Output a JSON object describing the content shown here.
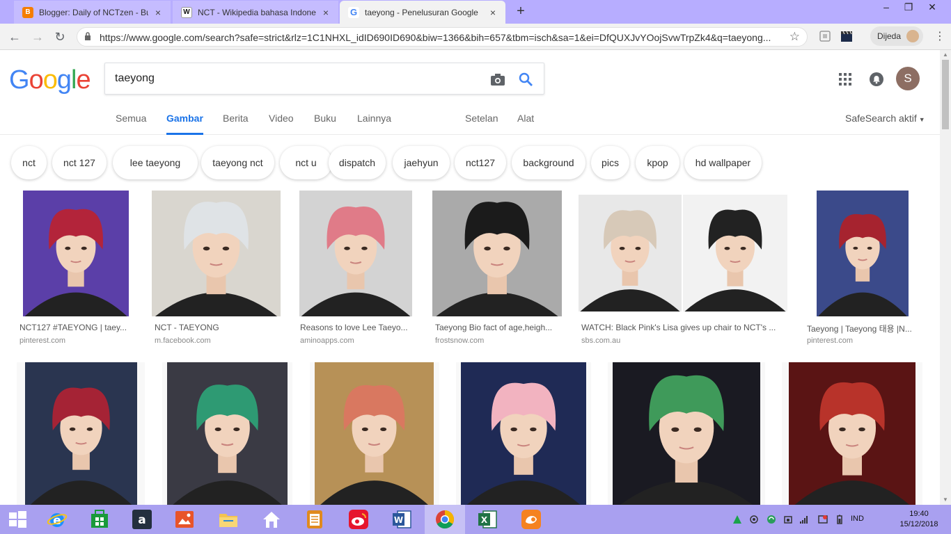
{
  "browser": {
    "tabs": [
      {
        "title": "Blogger: Daily of NCTzen - Buat e",
        "favicon": "blogger-icon",
        "favicon_color": "#f57d00",
        "favicon_letter": "B"
      },
      {
        "title": "NCT - Wikipedia bahasa Indonesi",
        "favicon": "wikipedia-icon",
        "favicon_color": "#ffffff",
        "favicon_letter": "W"
      },
      {
        "title": "taeyong - Penelusuran Google",
        "favicon": "google-icon",
        "favicon_color": "#4285f4",
        "favicon_letter": "G"
      }
    ],
    "url": "https://www.google.com/search?safe=strict&rlz=1C1NHXL_idID690ID690&biw=1366&bih=657&tbm=isch&sa=1&ei=DfQUXJvYOojSvwTrpZk4&q=taeyong...",
    "profile_name": "Dijeda"
  },
  "google": {
    "logo_letters": [
      {
        "ch": "G",
        "color": "#4285f4"
      },
      {
        "ch": "o",
        "color": "#ea4335"
      },
      {
        "ch": "o",
        "color": "#fbbc05"
      },
      {
        "ch": "g",
        "color": "#4285f4"
      },
      {
        "ch": "l",
        "color": "#34a853"
      },
      {
        "ch": "e",
        "color": "#ea4335"
      }
    ],
    "query": "taeyong",
    "avatar_letter": "S",
    "nav": {
      "all": "Semua",
      "images": "Gambar",
      "news": "Berita",
      "video": "Video",
      "books": "Buku",
      "more": "Lainnya",
      "settings": "Setelan",
      "tools": "Alat",
      "safesearch": "SafeSearch aktif"
    },
    "chips": [
      "nct",
      "nct 127",
      "lee taeyong",
      "taeyong nct",
      "nct u",
      "dispatch",
      "jaehyun",
      "nct127",
      "background",
      "pics",
      "kpop",
      "hd wallpaper"
    ],
    "results_row1": [
      {
        "title": "NCT127 #TAEYONG | taey...",
        "source": "pinterest.com",
        "bg": "#5b3fa8",
        "hair": "#b3243a"
      },
      {
        "title": "NCT - TAEYONG",
        "source": "m.facebook.com",
        "bg": "#d9d6cf",
        "hair": "#dfe3e6"
      },
      {
        "title": "Reasons to love Lee Taeyo...",
        "source": "aminoapps.com",
        "bg": "#d3d3d3",
        "hair": "#e07b88"
      },
      {
        "title": "Taeyong Bio fact of age,heigh...",
        "source": "frostsnow.com",
        "bg": "#aaaaaa",
        "hair": "#1b1b1b"
      },
      {
        "title": "WATCH: Black Pink's Lisa gives up chair to NCT's ...",
        "source": "sbs.com.au",
        "bg": "#e8e8e8",
        "hair": "#222222"
      },
      {
        "title": "Taeyong | Taeyong 태용 |N...",
        "source": "pinterest.com",
        "bg": "#3b4a8a",
        "hair": "#a6232f"
      }
    ],
    "results_row2": [
      {
        "bg": "#2a3550",
        "hair": "#a52335"
      },
      {
        "bg": "#3a3a44",
        "hair": "#2e9a73"
      },
      {
        "bg": "#b79157",
        "hair": "#d97860"
      },
      {
        "bg": "#1f2a55",
        "hair": "#f2b3c0"
      },
      {
        "bg": "#1a1a22",
        "hair": "#3f9a5a"
      },
      {
        "bg": "#5a1414",
        "hair": "#b8332a"
      }
    ]
  },
  "taskbar": {
    "lang": "IND",
    "time": "19:40",
    "date": "15/12/2018"
  },
  "colors": {
    "tabstrip": "#b7adff",
    "google_blue": "#1a73e8",
    "taskbar": "#a9a0f0"
  }
}
